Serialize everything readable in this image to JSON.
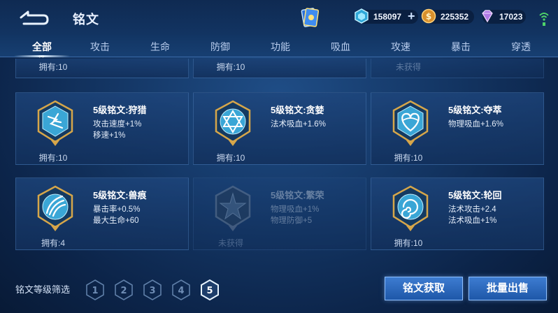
{
  "header": {
    "title": "铭文",
    "currencies": [
      {
        "icon": "diamond-gem-icon",
        "value": "158097",
        "has_plus": true
      },
      {
        "icon": "gold-coin-icon",
        "value": "225352"
      },
      {
        "icon": "purple-crystal-icon",
        "value": "17023"
      }
    ]
  },
  "tabs": [
    "全部",
    "攻击",
    "生命",
    "防御",
    "功能",
    "吸血",
    "攻速",
    "暴击",
    "穿透"
  ],
  "active_tab": "全部",
  "top_row": [
    {
      "owned": "拥有:10"
    },
    {
      "owned": "拥有:10"
    },
    {
      "owned": "未获得"
    }
  ],
  "cards": [
    {
      "name": "5级铭文:狩猎",
      "attrs": [
        "攻击速度+1%",
        "移速+1%"
      ],
      "owned": "拥有:10",
      "obtained": true,
      "icon": "lightning-rune-icon"
    },
    {
      "name": "5级铭文:贪婪",
      "attrs": [
        "法术吸血+1.6%"
      ],
      "owned": "拥有:10",
      "obtained": true,
      "icon": "hexagram-rune-icon"
    },
    {
      "name": "5级铭文:夺萃",
      "attrs": [
        "物理吸血+1.6%"
      ],
      "owned": "拥有:10",
      "obtained": true,
      "icon": "heart-knot-rune-icon"
    },
    {
      "name": "5级铭文:兽痕",
      "attrs": [
        "暴击率+0.5%",
        "最大生命+60"
      ],
      "owned": "拥有:4",
      "obtained": true,
      "icon": "claw-rune-icon"
    },
    {
      "name": "5级铭文:繁荣",
      "attrs": [
        "物理吸血+1%",
        "物理防御+5"
      ],
      "owned": "未获得",
      "obtained": false,
      "icon": "star-rune-icon"
    },
    {
      "name": "5级铭文:轮回",
      "attrs": [
        "法术攻击+2.4",
        "法术吸血+1%"
      ],
      "owned": "拥有:10",
      "obtained": true,
      "icon": "swirl-rune-icon"
    }
  ],
  "footer": {
    "filter_label": "铭文等级筛选",
    "levels": [
      "1",
      "2",
      "3",
      "4",
      "5"
    ],
    "selected_level": "5",
    "obtain_button": "铭文获取",
    "sell_button": "批量出售"
  }
}
